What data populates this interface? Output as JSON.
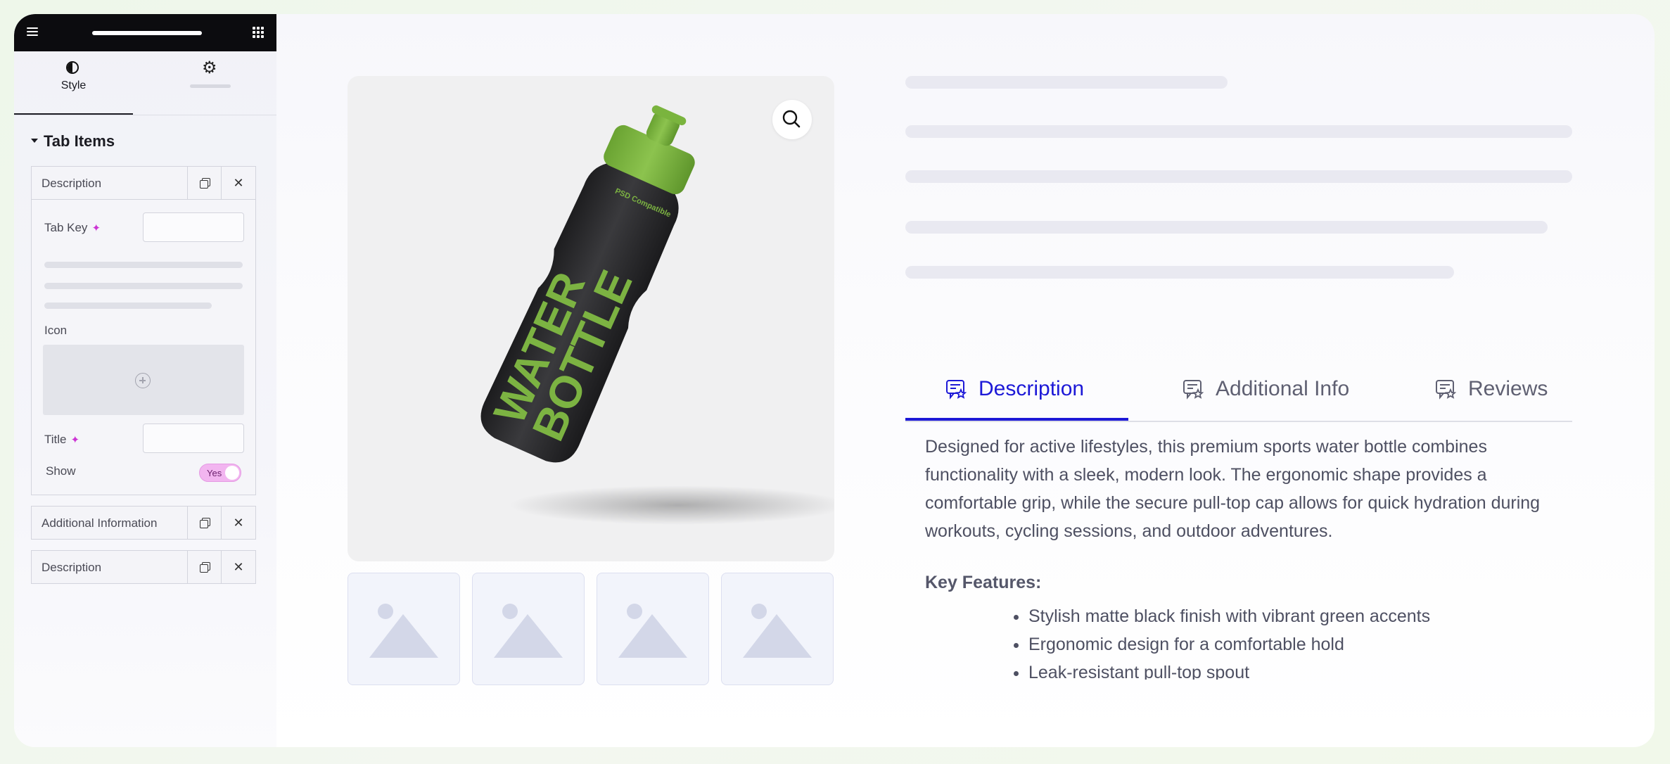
{
  "editor": {
    "tabs": {
      "style_label": "Style"
    },
    "section_title": "Tab Items",
    "items": [
      {
        "label": "Description"
      },
      {
        "label": "Additional Information"
      },
      {
        "label": "Description"
      }
    ],
    "fields": {
      "tab_key_label": "Tab Key",
      "icon_label": "Icon",
      "title_label": "Title",
      "show_label": "Show",
      "show_toggle_text": "Yes"
    }
  },
  "product": {
    "bottle_text_line1": "WATER",
    "bottle_text_line2": "BOTTLE",
    "bottle_small_text": "PSD Compatible",
    "tabs": [
      {
        "label": "Description"
      },
      {
        "label": "Additional Info"
      },
      {
        "label": "Reviews"
      }
    ],
    "description": "Designed for active lifestyles, this premium sports water bottle combines functionality with a sleek, modern look. The ergonomic shape provides a comfortable grip, while the secure pull-top cap allows for quick hydration during workouts, cycling sessions, and outdoor adventures.",
    "key_features_title": "Key Features:",
    "features": [
      "Stylish matte black finish with vibrant green accents",
      "Ergonomic design for a comfortable hold",
      "Leak-resistant pull-top spout"
    ]
  },
  "colors": {
    "accent": "#1d19d7",
    "toggle_on": "#f2b5f0",
    "bottle_green": "#7cb342",
    "bottle_black": "#2a2a2c"
  }
}
